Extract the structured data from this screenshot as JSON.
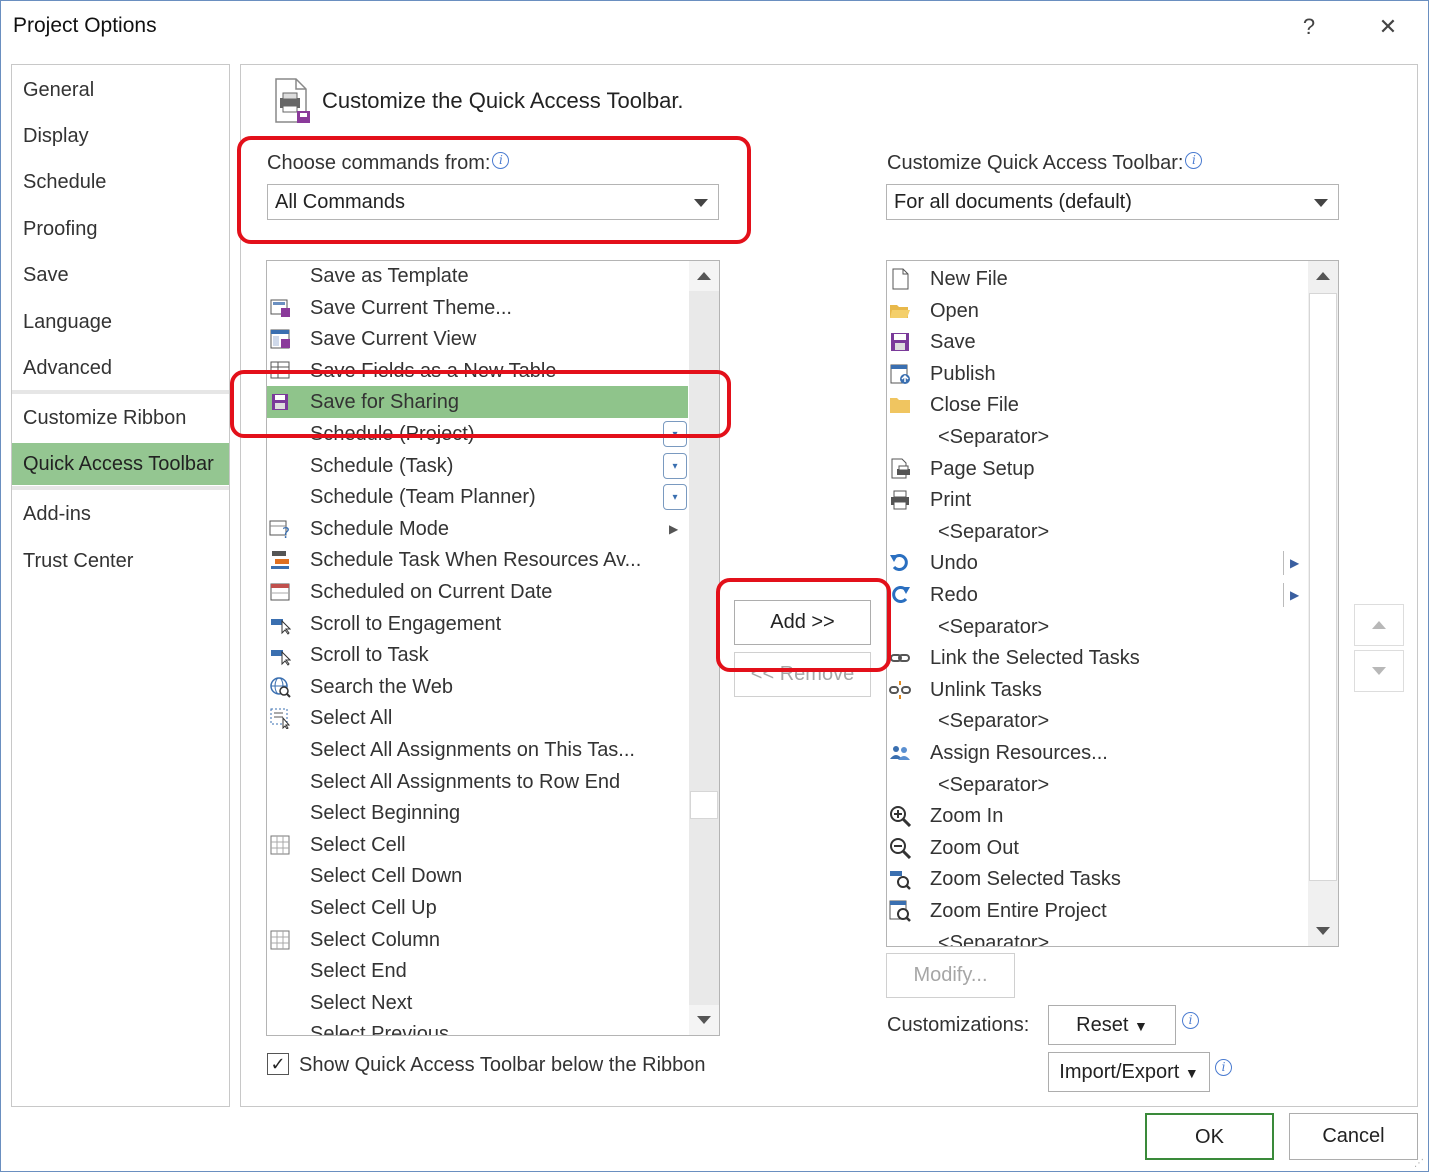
{
  "window": {
    "title": "Project Options",
    "help_glyph": "?",
    "close_glyph": "✕"
  },
  "sidebar": {
    "items": [
      {
        "label": "General"
      },
      {
        "label": "Display"
      },
      {
        "label": "Schedule"
      },
      {
        "label": "Proofing"
      },
      {
        "label": "Save"
      },
      {
        "label": "Language"
      },
      {
        "label": "Advanced"
      },
      {
        "label": "Customize Ribbon"
      },
      {
        "label": "Quick Access Toolbar",
        "active": true
      },
      {
        "label": "Add-ins"
      },
      {
        "label": "Trust Center"
      }
    ]
  },
  "main": {
    "heading": "Customize the Quick Access Toolbar.",
    "choose_label": "Choose commands from:",
    "choose_value": "All Commands",
    "target_label": "Customize Quick Access Toolbar:",
    "target_value": "For all documents (default)",
    "commands": [
      {
        "label": "Save as Template",
        "icon": ""
      },
      {
        "label": "Save Current Theme...",
        "icon": "theme-icon"
      },
      {
        "label": "Save Current View",
        "icon": "view-icon"
      },
      {
        "label": "Save Fields as a New Table",
        "icon": "table-icon"
      },
      {
        "label": "Save for Sharing",
        "icon": "save-share-icon",
        "selected": true
      },
      {
        "label": "Schedule (Project)",
        "icon": "",
        "dropdown": true
      },
      {
        "label": "Schedule (Task)",
        "icon": "",
        "dropdown": true
      },
      {
        "label": "Schedule (Team Planner)",
        "icon": "",
        "dropdown": true
      },
      {
        "label": "Schedule Mode",
        "icon": "schedule-mode-icon",
        "submenu": true
      },
      {
        "label": "Schedule Task When Resources Av...",
        "icon": "schedule-task-icon"
      },
      {
        "label": "Scheduled on Current Date",
        "icon": "calendar-icon"
      },
      {
        "label": "Scroll to Engagement",
        "icon": "scroll-icon"
      },
      {
        "label": "Scroll to Task",
        "icon": "scroll-icon"
      },
      {
        "label": "Search the Web",
        "icon": "globe-search-icon"
      },
      {
        "label": "Select All",
        "icon": "select-all-icon"
      },
      {
        "label": "Select All Assignments on This Tas...",
        "icon": ""
      },
      {
        "label": "Select All Assignments to Row End",
        "icon": ""
      },
      {
        "label": "Select Beginning",
        "icon": ""
      },
      {
        "label": "Select Cell",
        "icon": "grid-icon"
      },
      {
        "label": "Select Cell Down",
        "icon": ""
      },
      {
        "label": "Select Cell Up",
        "icon": ""
      },
      {
        "label": "Select Column",
        "icon": "grid-icon"
      },
      {
        "label": "Select End",
        "icon": ""
      },
      {
        "label": "Select Next",
        "icon": ""
      },
      {
        "label": "Select Previous",
        "icon": ""
      }
    ],
    "toolbar_items": [
      {
        "label": "New File",
        "icon": "new-file-icon"
      },
      {
        "label": "Open",
        "icon": "folder-open-icon"
      },
      {
        "label": "Save",
        "icon": "save-icon"
      },
      {
        "label": "Publish",
        "icon": "publish-icon"
      },
      {
        "label": "Close File",
        "icon": "folder-icon"
      },
      {
        "label": "<Separator>",
        "sep": true
      },
      {
        "label": "Page Setup",
        "icon": "page-setup-icon"
      },
      {
        "label": "Print",
        "icon": "printer-icon"
      },
      {
        "label": "<Separator>",
        "sep": true
      },
      {
        "label": "Undo",
        "icon": "undo-icon",
        "submenu": true
      },
      {
        "label": "Redo",
        "icon": "redo-icon",
        "submenu": true
      },
      {
        "label": "<Separator>",
        "sep": true
      },
      {
        "label": "Link the Selected Tasks",
        "icon": "link-icon"
      },
      {
        "label": "Unlink Tasks",
        "icon": "unlink-icon"
      },
      {
        "label": "<Separator>",
        "sep": true
      },
      {
        "label": "Assign Resources...",
        "icon": "people-icon"
      },
      {
        "label": "<Separator>",
        "sep": true
      },
      {
        "label": "Zoom In",
        "icon": "zoom-in-icon"
      },
      {
        "label": "Zoom Out",
        "icon": "zoom-out-icon"
      },
      {
        "label": "Zoom Selected Tasks",
        "icon": "zoom-selected-icon"
      },
      {
        "label": "Zoom Entire Project",
        "icon": "zoom-entire-icon"
      },
      {
        "label": "<Separator>",
        "sep": true
      }
    ],
    "add_button": "Add >>",
    "remove_button": "<< Remove",
    "modify_button": "Modify...",
    "customizations_label": "Customizations:",
    "reset_button": "Reset",
    "import_export_button": "Import/Export",
    "show_below_ribbon": "Show Quick Access Toolbar below the Ribbon",
    "show_below_checked": true
  },
  "footer": {
    "ok": "OK",
    "cancel": "Cancel"
  },
  "colors": {
    "selection": "#8fc48b",
    "highlight_ring": "#e3101a",
    "border": "#c8c8c8"
  }
}
